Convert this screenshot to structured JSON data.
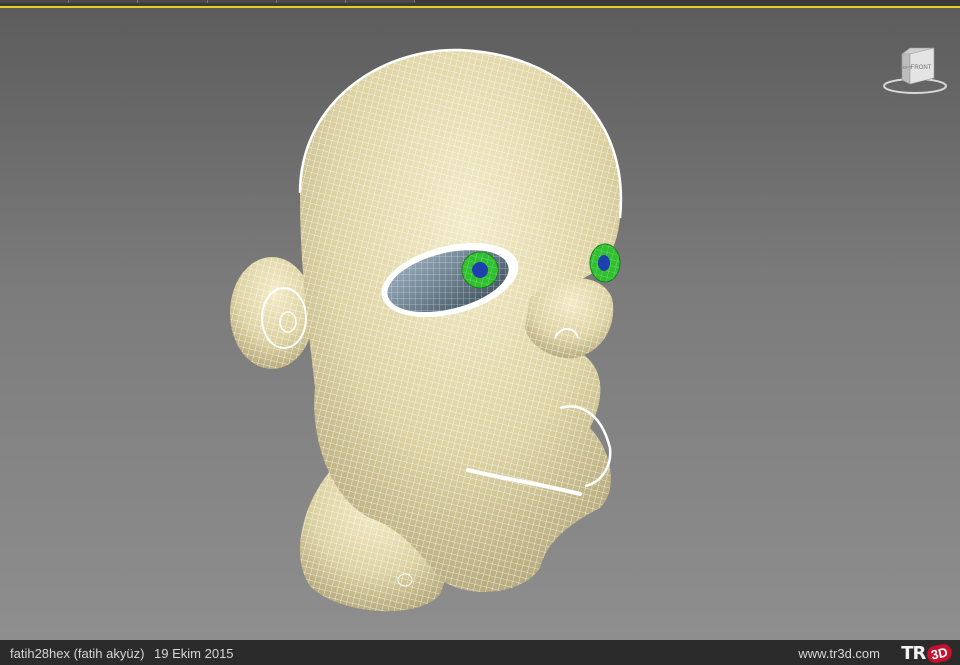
{
  "viewport": {
    "viewcube_label": "FRONT",
    "viewcube_side_label": "LEFT"
  },
  "footer": {
    "author": "fatih28hex (fatih akyüz)",
    "date": "19 Ekim 2015",
    "website": "www.tr3d.com",
    "logo_text": "TR",
    "logo_badge": "3D"
  },
  "colors": {
    "accent_line": "#e6cf1e",
    "skin": "#e9dfaf",
    "wire": "#ffffff",
    "iris": "#2fc02f",
    "pupil": "#1e3fb0",
    "logo_red": "#c8102e"
  },
  "icons": [
    "viewcube-icon",
    "logo-icon"
  ]
}
